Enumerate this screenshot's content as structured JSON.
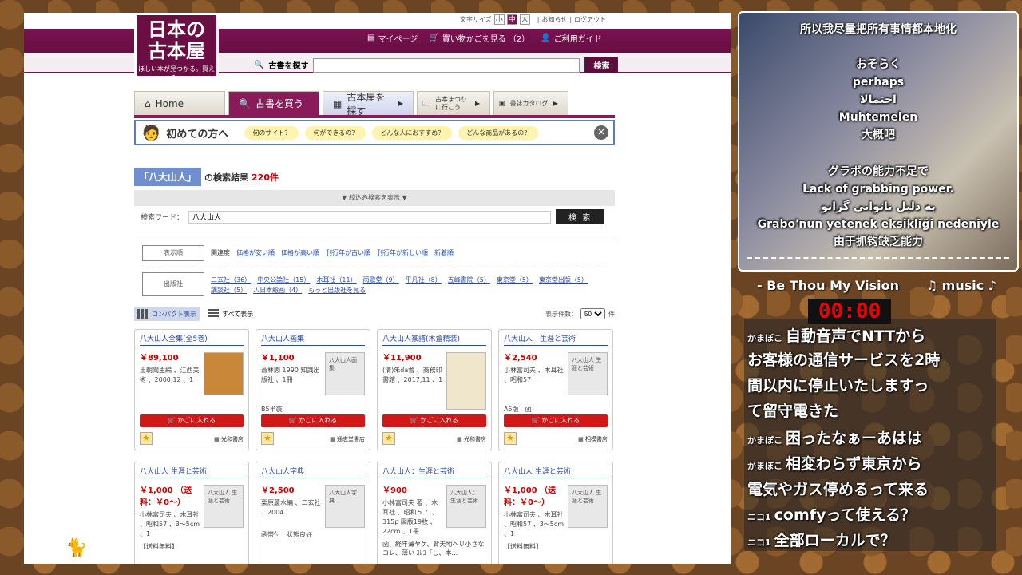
{
  "site": {
    "logo_line1": "日本の",
    "logo_line2": "古本屋",
    "logo_tag": "ほしい本が見つかる。買える。",
    "font_size_label": "文字サイズ",
    "font_sizes": [
      "小",
      "中",
      "大"
    ],
    "notice": "お知らせ",
    "login": "ログアウト",
    "mypage": "マイページ",
    "cart": "買い物かごを見る （2）",
    "guide": "ご利用ガイド",
    "search_label": "古書を探す",
    "search_button": "検索"
  },
  "tabs": [
    "Home",
    "古書を買う",
    "古本屋を探す",
    "古本まつりに行こう",
    "書誌カタログ"
  ],
  "firstbar": {
    "title": "初めての方へ",
    "pills": [
      "何のサイト？",
      "何ができるの？",
      "どんな人におすすめ？",
      "どんな商品があるの？"
    ]
  },
  "result": {
    "keyword": "「八大山人」",
    "middle": "の検索結果",
    "count": "220件"
  },
  "filter_toggle": "▼ 絞込み検索を表示 ▼",
  "keyword_row": {
    "label": "検索ワード：",
    "value": "八大山人",
    "button": "検 索"
  },
  "sort": {
    "label": "表示順",
    "current": "関連度",
    "options": [
      "価格が安い順",
      "価格が高い順",
      "刊行年が古い順",
      "刊行年が新しい順",
      "新着順"
    ]
  },
  "publisher": {
    "label": "出版社",
    "items": [
      "二玄社（36）",
      "中央公論社（15）",
      "木耳社（11）",
      "雨歌堂（9）",
      "平凡社（8）",
      "五峰書院（5）",
      "東京堂（5）",
      "東京堂出版（5）",
      "講談社（5）",
      "人日本絵画（4）",
      "もっと出版社を見る"
    ]
  },
  "view": {
    "compact": "コンパクト表示",
    "full": "すべて表示",
    "perpage_label": "表示件数：",
    "perpage_value": "50",
    "perpage_unit": "件"
  },
  "cart_label": "かごに入れる",
  "cards": [
    {
      "title": "八大山人全集(全5巻)",
      "price": "￥89,100",
      "desc": "王朝聞主編 、江西美術 、2000,12 、1",
      "extra": "",
      "shop": "光和書房",
      "thumb": ""
    },
    {
      "title": "八大山人画集",
      "price": "￥1,100",
      "desc": "蒼林閣 1990 知識出版社 、1冊",
      "extra": "B5半装",
      "shop": "通志堂書店",
      "thumb": "八大山人画集"
    },
    {
      "title": "八大山人篆譜(木盒精装)",
      "price": "￥11,900",
      "desc": "(清)朱da耆 、商務印書館 、2017,11 、1",
      "extra": "",
      "shop": "光和書房",
      "thumb": ""
    },
    {
      "title": "八大山人　生涯と芸術",
      "price": "￥2,540",
      "desc": "小林富司夫 、木耳社 、昭和57",
      "extra": "A5版　函",
      "shop": "相模書房",
      "thumb": "八大山人 生涯と芸術"
    },
    {
      "title": "八大山人 生涯と芸術",
      "price": "￥1,000 （送料：￥0〜）",
      "desc": "小林富司夫 、木耳社 、昭和57 、3〜5cm 、1",
      "extra": "【送料無料】",
      "shop": "",
      "thumb": "八大山人 生涯と芸術"
    },
    {
      "title": "八大山人字典",
      "price": "￥2,500",
      "desc": "栗原蘆水編 、二玄社 、2004",
      "extra": "函帯付　状態良好",
      "shop": "",
      "thumb": "八大山人字典"
    },
    {
      "title": "八大山人：生涯と芸術",
      "price": "￥900",
      "desc": "小林富司夫 著 、木耳社 、昭和５７ 、315p 図版19枚 、22cm 、1冊",
      "extra": "函、経年薄ヤケ、背天地ヘリ小さなコレ、薄い ｽﾚｺ「し、本...",
      "shop": "",
      "thumb": "八大山人：生涯と芸術"
    },
    {
      "title": "八大山人 生涯と芸術",
      "price": "￥1,000 （送料：￥0〜）",
      "desc": "小林富司夫 、木耳社 、昭和57 、3〜5cm 、1",
      "extra": "【送料無料】",
      "shop": "",
      "thumb": "八大山人 生涯と芸術"
    }
  ],
  "stream": {
    "top": "所以我尽量把所有事情都本地化",
    "sub1": [
      "おそらく",
      "perhaps",
      "احتمالا",
      "Muhtemelen",
      "大概吧"
    ],
    "sub2": [
      "グラボの能力不足で",
      "Lack of grabbing power.",
      "به دلیل ناتوانی گرابو",
      "Grabo'nun yetenek eksikliği nedeniyle",
      "由于抓钩缺乏能力"
    ],
    "music_title": "- Be Thou My Vision",
    "music_tag": "♫ music ♪",
    "timer": "00:00",
    "chat": [
      {
        "name": "かまぼこ",
        "text": "自動音声でNTTから"
      },
      {
        "name": "",
        "text": "お客様の通信サービスを2時"
      },
      {
        "name": "",
        "text": "間以内に停止いたしますっ"
      },
      {
        "name": "",
        "text": "て留守電きた"
      },
      {
        "name": "かまぼこ",
        "text": "困ったなぁーあはは"
      },
      {
        "name": "かまぼこ",
        "text": "相変わらず東京から"
      },
      {
        "name": "",
        "text": "電気やガス停めるって来る"
      },
      {
        "name": "ニコ1",
        "text": "comfyって使える？"
      },
      {
        "name": "ニコ1",
        "text": "全部ローカルで？"
      }
    ]
  }
}
